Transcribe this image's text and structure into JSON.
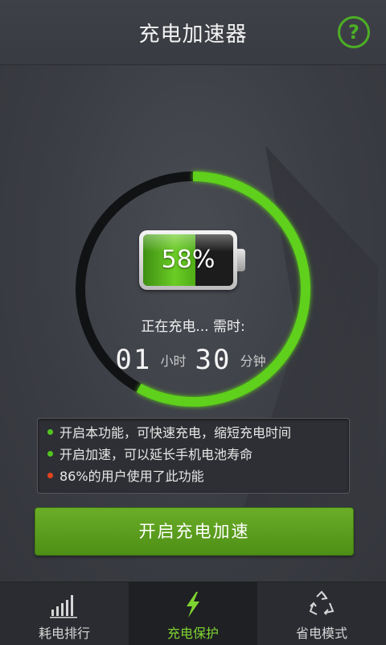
{
  "header": {
    "title": "充电加速器",
    "help_label": "?"
  },
  "battery": {
    "percent_text": "58%",
    "level": 0.58
  },
  "charge_ring": {
    "progress": 0.58
  },
  "status": {
    "charging_label": "正在充电... 需时:",
    "hours": "01",
    "hours_unit": "小时",
    "minutes": "30",
    "minutes_unit": "分钟"
  },
  "info": {
    "lines": [
      {
        "text": "开启本功能，可快速充电，缩短充电时间",
        "dot_color": "#53c41f"
      },
      {
        "text": "开启加速，可以延长手机电池寿命",
        "dot_color": "#53c41f"
      },
      {
        "text": "86%的用户使用了此功能",
        "dot_color": "#e2421c"
      }
    ]
  },
  "cta": {
    "label": "开启充电加速"
  },
  "tabs": [
    {
      "label": "耗电排行",
      "icon": "bar-chart-icon",
      "active": false
    },
    {
      "label": "充电保护",
      "icon": "lightning-icon",
      "active": true
    },
    {
      "label": "省电模式",
      "icon": "recycle-icon",
      "active": false
    }
  ],
  "colors": {
    "accent": "#53c41f",
    "background": "#3a3c43"
  }
}
